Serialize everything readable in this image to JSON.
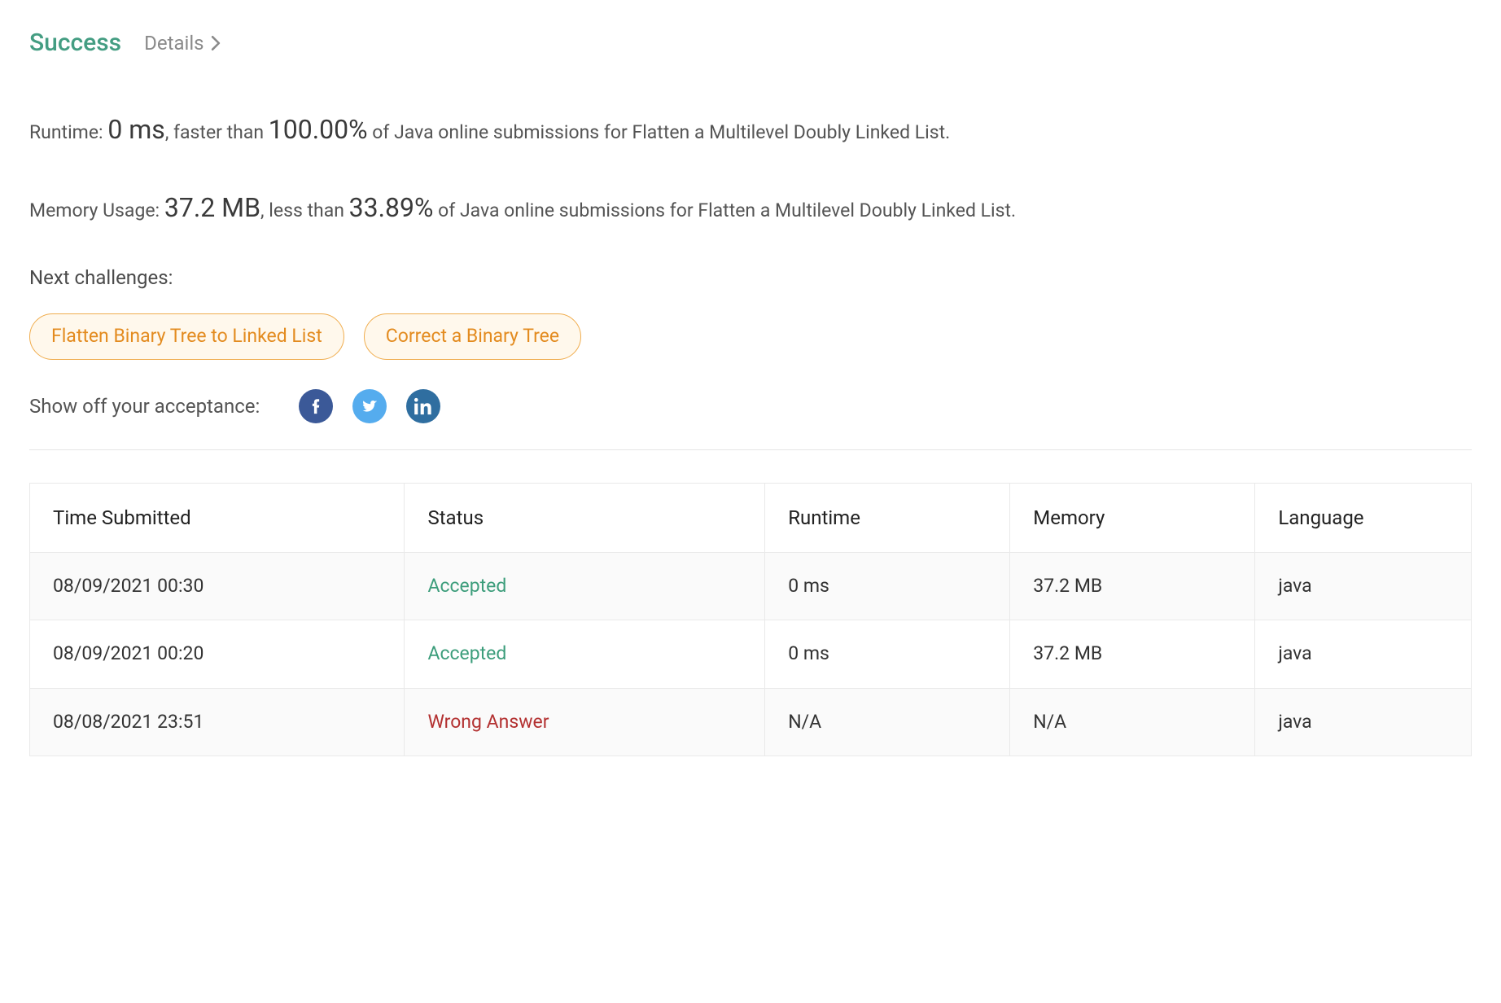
{
  "header": {
    "success_label": "Success",
    "details_label": "Details"
  },
  "runtime_line": {
    "prefix": "Runtime: ",
    "value": "0 ms",
    "middle": ", faster than ",
    "percent": "100.00%",
    "suffix": " of Java online submissions for Flatten a Multilevel Doubly Linked List."
  },
  "memory_line": {
    "prefix": "Memory Usage: ",
    "value": "37.2 MB",
    "middle": ", less than ",
    "percent": "33.89%",
    "suffix": " of Java online submissions for Flatten a Multilevel Doubly Linked List."
  },
  "next_challenges": {
    "label": "Next challenges:",
    "items": [
      "Flatten Binary Tree to Linked List",
      "Correct a Binary Tree"
    ]
  },
  "share": {
    "label": "Show off your acceptance:"
  },
  "table": {
    "headers": {
      "time": "Time Submitted",
      "status": "Status",
      "runtime": "Runtime",
      "memory": "Memory",
      "language": "Language"
    },
    "rows": [
      {
        "time": "08/09/2021 00:30",
        "status": "Accepted",
        "status_kind": "accepted",
        "runtime": "0 ms",
        "memory": "37.2 MB",
        "language": "java"
      },
      {
        "time": "08/09/2021 00:20",
        "status": "Accepted",
        "status_kind": "accepted",
        "runtime": "0 ms",
        "memory": "37.2 MB",
        "language": "java"
      },
      {
        "time": "08/08/2021 23:51",
        "status": "Wrong Answer",
        "status_kind": "wrong",
        "runtime": "N/A",
        "memory": "N/A",
        "language": "java"
      }
    ]
  }
}
